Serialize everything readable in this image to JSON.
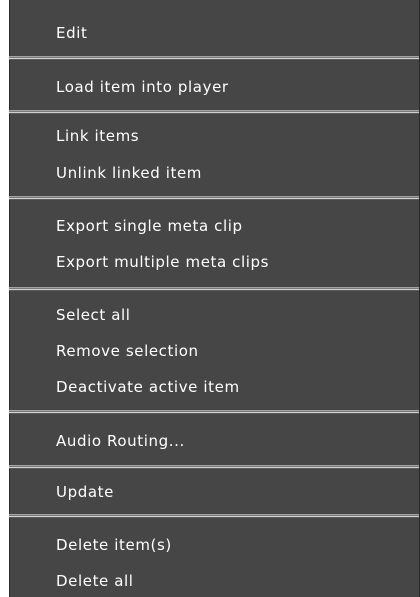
{
  "context_menu": {
    "groups": [
      {
        "items": [
          {
            "label": "Edit"
          }
        ]
      },
      {
        "items": [
          {
            "label": "Load item into player"
          }
        ]
      },
      {
        "items": [
          {
            "label": "Link items"
          },
          {
            "label": "Unlink linked item"
          }
        ]
      },
      {
        "items": [
          {
            "label": "Export single meta clip"
          },
          {
            "label": "Export multiple meta clips"
          }
        ]
      },
      {
        "items": [
          {
            "label": "Select all"
          },
          {
            "label": "Remove selection"
          },
          {
            "label": "Deactivate active item"
          }
        ]
      },
      {
        "items": [
          {
            "label": "Audio Routing..."
          }
        ]
      },
      {
        "items": [
          {
            "label": "Update"
          }
        ]
      },
      {
        "items": [
          {
            "label": "Delete item(s)"
          },
          {
            "label": "Delete all"
          }
        ]
      }
    ]
  },
  "colors": {
    "menu_background": "#464646",
    "text": "#ffffff",
    "separator_light": "#d0d0d0",
    "separator_dark": "#5c5c5c"
  }
}
